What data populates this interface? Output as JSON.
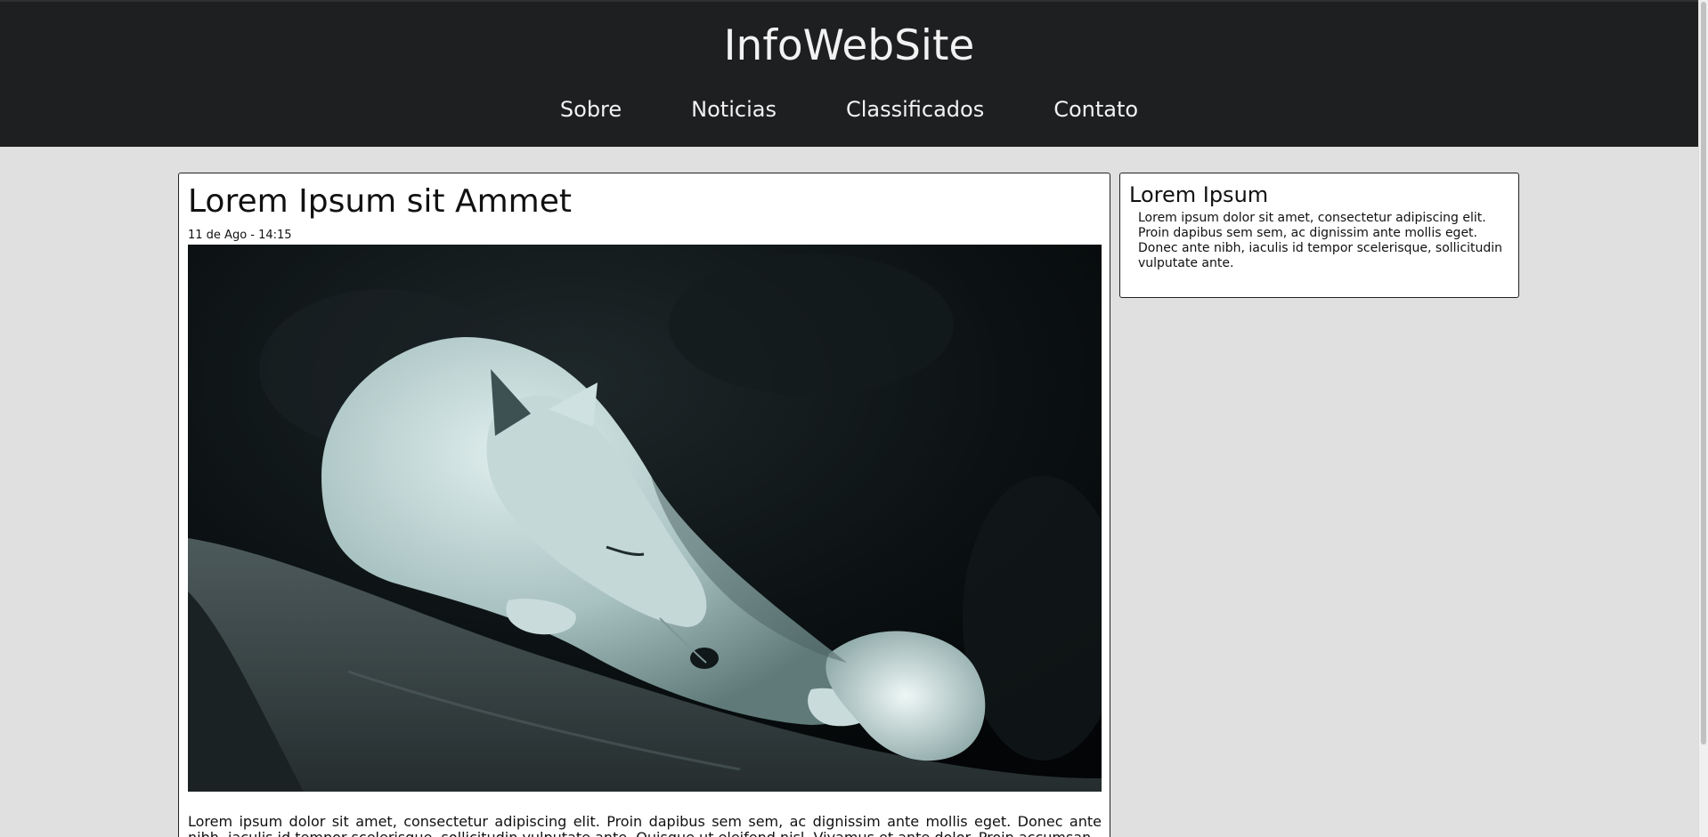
{
  "header": {
    "site_title": "InfoWebSite",
    "nav": [
      "Sobre",
      "Noticias",
      "Classificados",
      "Contato"
    ]
  },
  "article": {
    "title": "Lorem Ipsum sit Ammet",
    "date": "11 de Ago - 14:15",
    "image_subject": "sleeping white wolf on a rock",
    "text": "Lorem ipsum dolor sit amet, consectetur adipiscing elit. Proin dapibus sem sem, ac dignissim ante mollis eget. Donec ante nibh, iaculis id tempor scelerisque, sollicitudin vulputate ante. Quisque ut eleifend nisl. Vivamus et ante dolor. Proin accumsan"
  },
  "sidebar": {
    "title": "Lorem Ipsum",
    "text": "Lorem ipsum dolor sit amet, consectetur adipiscing elit. Proin dapibus sem sem, ac dignissim ante mollis eget. Donec ante nibh, iaculis id tempor scelerisque, sollicitudin vulputate ante."
  },
  "colors": {
    "header_bg": "#1e1f21",
    "page_bg": "#e0e0e0",
    "header_text": "#f2f2f2"
  }
}
